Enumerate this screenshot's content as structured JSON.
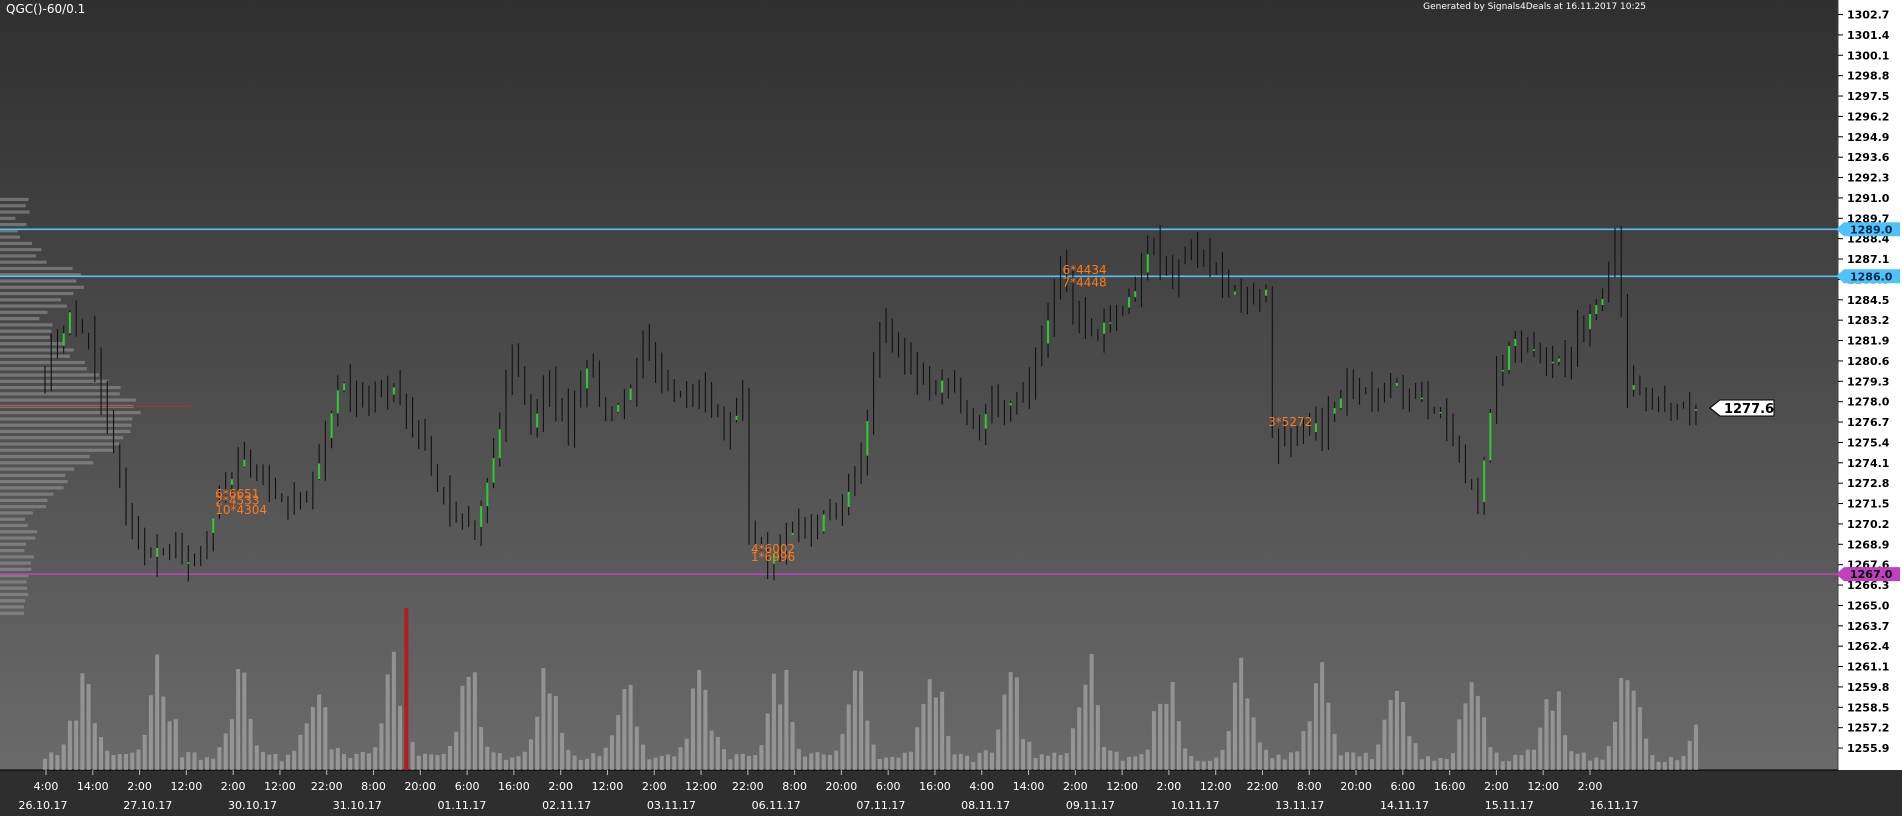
{
  "header": {
    "symbol": "QGC()-60/0.1",
    "generated": "Generated by Signals4Deals at 16.11.2017 10:25"
  },
  "colors": {
    "background_top": "#2f2f2f",
    "background_bottom": "#6a6a6a",
    "resistance": "#4fc3f7",
    "support": "#c040c0",
    "price_badge": "#ffffff",
    "signal_text": "#ff7a1a",
    "bull_bar": "#2ecc2e",
    "bear_bar": "#111111",
    "volume": "#b9b9b9",
    "volume_spike": "#b21e1e",
    "profile": "#9a9a9a"
  },
  "chart_data": {
    "type": "candlestick",
    "title": "QGC()-60/0.1",
    "ylim": [
      1254.5,
      1303.5
    ],
    "grid": false,
    "y_ticks": [
      "1302.7",
      "1301.4",
      "1300.1",
      "1298.8",
      "1297.5",
      "1296.2",
      "1294.9",
      "1293.6",
      "1292.3",
      "1291.0",
      "1289.7",
      "1288.4",
      "1287.1",
      "1285.8",
      "1284.5",
      "1283.2",
      "1281.9",
      "1280.6",
      "1279.3",
      "1278.0",
      "1276.7",
      "1275.4",
      "1274.1",
      "1272.8",
      "1271.5",
      "1270.2",
      "1268.9",
      "1267.6",
      "1266.3",
      "1265.0",
      "1263.7",
      "1262.4",
      "1261.1",
      "1259.8",
      "1258.5",
      "1257.2",
      "1255.9"
    ],
    "x_time_ticks": [
      "4:00",
      "14:00",
      "2:00",
      "12:00",
      "2:00",
      "12:00",
      "22:00",
      "8:00",
      "20:00",
      "6:00",
      "16:00",
      "2:00",
      "12:00",
      "2:00",
      "12:00",
      "22:00",
      "8:00",
      "20:00",
      "6:00",
      "16:00",
      "4:00",
      "14:00",
      "2:00",
      "12:00",
      "2:00",
      "12:00",
      "22:00",
      "8:00",
      "20:00",
      "6:00",
      "16:00",
      "2:00",
      "12:00",
      "2:00"
    ],
    "x_date_ticks": [
      "26.10.17",
      "27.10.17",
      "30.10.17",
      "31.10.17",
      "01.11.17",
      "02.11.17",
      "03.11.17",
      "06.11.17",
      "07.11.17",
      "08.11.17",
      "09.11.17",
      "10.11.17",
      "13.11.17",
      "14.11.17",
      "15.11.17",
      "16.11.17"
    ],
    "horizontal_levels": [
      {
        "value": 1289.0,
        "label": "1289.0",
        "kind": "resistance"
      },
      {
        "value": 1286.0,
        "label": "1286.0",
        "kind": "resistance"
      },
      {
        "value": 1267.0,
        "label": "1267.0",
        "kind": "support"
      }
    ],
    "last_price": {
      "value": 1277.6,
      "label": "1277.6"
    },
    "signals": [
      {
        "bar": 27,
        "value": 1272.1,
        "label": "6*6651"
      },
      {
        "bar": 27,
        "value": 1271.7,
        "label": "2*4533"
      },
      {
        "bar": 27,
        "value": 1271.1,
        "label": "10*4304"
      },
      {
        "bar": 113,
        "value": 1268.6,
        "label": "4*6002"
      },
      {
        "bar": 113,
        "value": 1268.1,
        "label": "1*6996"
      },
      {
        "bar": 163,
        "value": 1286.4,
        "label": "6*4434"
      },
      {
        "bar": 163,
        "value": 1285.6,
        "label": "7*4448"
      },
      {
        "bar": 196,
        "value": 1276.7,
        "label": "3*5272"
      }
    ],
    "series_waypoints": [
      [
        0,
        1280.0
      ],
      [
        4,
        1283.5
      ],
      [
        7,
        1282.0
      ],
      [
        10,
        1276.5
      ],
      [
        13,
        1271.0
      ],
      [
        16,
        1268.5
      ],
      [
        20,
        1268.5
      ],
      [
        24,
        1267.5
      ],
      [
        28,
        1271.5
      ],
      [
        31,
        1274.0
      ],
      [
        34,
        1274.0
      ],
      [
        38,
        1271.5
      ],
      [
        41,
        1271.8
      ],
      [
        44,
        1274.0
      ],
      [
        47,
        1279.0
      ],
      [
        52,
        1278.0
      ],
      [
        56,
        1279.0
      ],
      [
        60,
        1276.0
      ],
      [
        63,
        1272.5
      ],
      [
        66,
        1270.0
      ],
      [
        69,
        1270.0
      ],
      [
        72,
        1274.0
      ],
      [
        75,
        1281.0
      ],
      [
        78,
        1276.5
      ],
      [
        81,
        1279.0
      ],
      [
        84,
        1276.5
      ],
      [
        87,
        1280.5
      ],
      [
        90,
        1277.5
      ],
      [
        93,
        1278.0
      ],
      [
        96,
        1281.5
      ],
      [
        99,
        1278.5
      ],
      [
        102,
        1279.0
      ],
      [
        106,
        1278.5
      ],
      [
        109,
        1276.0
      ],
      [
        112,
        1278.0
      ],
      [
        113,
        1270.0
      ],
      [
        116,
        1268.0
      ],
      [
        120,
        1269.5
      ],
      [
        124,
        1270.0
      ],
      [
        128,
        1271.5
      ],
      [
        131,
        1274.5
      ],
      [
        134,
        1282.5
      ],
      [
        137,
        1282.0
      ],
      [
        141,
        1279.0
      ],
      [
        145,
        1279.0
      ],
      [
        148,
        1277.0
      ],
      [
        150,
        1276.5
      ],
      [
        153,
        1278.0
      ],
      [
        157,
        1278.0
      ],
      [
        160,
        1281.5
      ],
      [
        163,
        1287.0
      ],
      [
        166,
        1283.0
      ],
      [
        169,
        1282.0
      ],
      [
        172,
        1284.0
      ],
      [
        175,
        1285.0
      ],
      [
        178,
        1288.0
      ],
      [
        181,
        1286.0
      ],
      [
        184,
        1288.0
      ],
      [
        187,
        1287.0
      ],
      [
        190,
        1285.0
      ],
      [
        193,
        1285.0
      ],
      [
        196,
        1285.0
      ],
      [
        197,
        1276.0
      ],
      [
        200,
        1275.0
      ],
      [
        205,
        1276.5
      ],
      [
        210,
        1279.0
      ],
      [
        215,
        1279.0
      ],
      [
        220,
        1278.5
      ],
      [
        225,
        1276.5
      ],
      [
        228,
        1273.0
      ],
      [
        230,
        1272.0
      ],
      [
        233,
        1279.5
      ],
      [
        236,
        1282.0
      ],
      [
        240,
        1281.0
      ],
      [
        244,
        1280.5
      ],
      [
        247,
        1283.0
      ],
      [
        250,
        1285.0
      ],
      [
        252,
        1289.0
      ],
      [
        254,
        1279.0
      ],
      [
        257,
        1278.0
      ],
      [
        260,
        1277.5
      ],
      [
        263,
        1277.5
      ],
      [
        265,
        1277.6
      ]
    ],
    "volume_spikes": [
      {
        "bar": 58,
        "kind": "highlight"
      }
    ]
  }
}
